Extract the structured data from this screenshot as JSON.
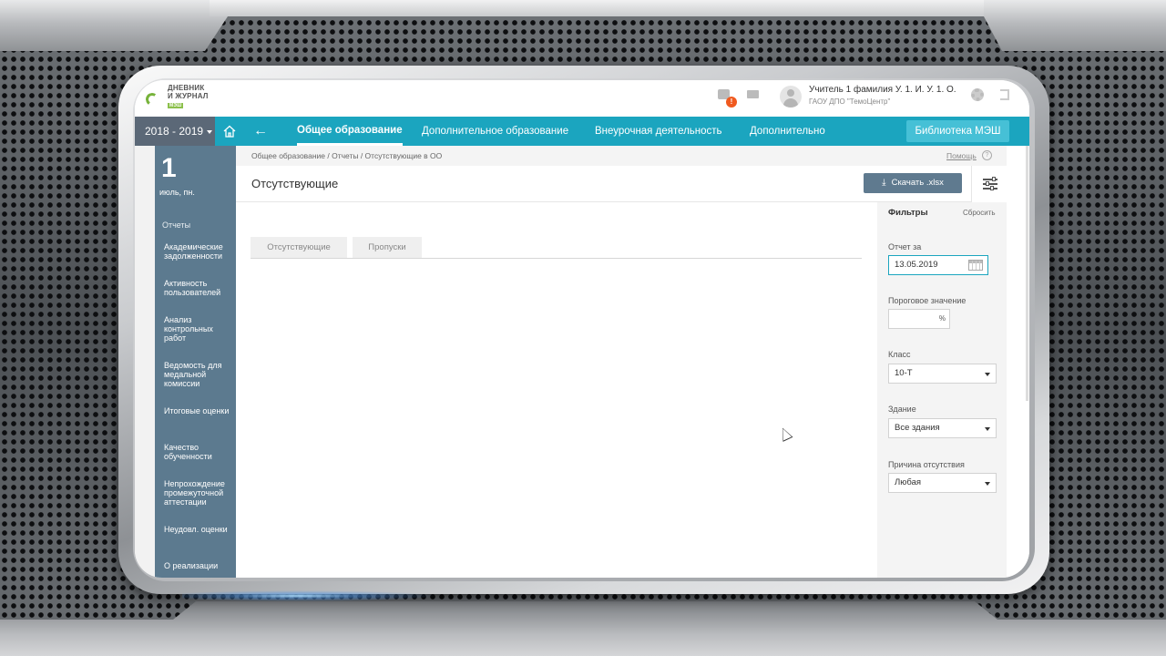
{
  "header": {
    "logo_line1": "ДНЕВНИК",
    "logo_line2": "И ЖУРНАЛ",
    "logo_badge": "МЭШ",
    "alert_count": "!",
    "user_name": "Учитель 1 фамилия У. 1. И. У. 1. О.",
    "user_org": "ГАОУ ДПО \"ТемоЦентр\""
  },
  "nav": {
    "year": "2018 - 2019",
    "items": [
      {
        "label": "Общее образование",
        "active": true
      },
      {
        "label": "Дополнительное образование",
        "active": false
      },
      {
        "label": "Внеурочная деятельность",
        "active": false
      },
      {
        "label": "Дополнительно",
        "active": false
      }
    ],
    "library_button": "Библиотека МЭШ"
  },
  "sidebar": {
    "date_number": "1",
    "date_label": "июль, пн.",
    "section": "Отчеты",
    "items": [
      "Академические задолженности",
      "Активность пользователей",
      "Анализ контрольных работ",
      "Ведомость для медальной комиссии",
      "Итоговые оценки",
      "Качество обученности",
      "Непрохождение промежуточной аттестации",
      "Неудовл. оценки",
      "О реализации"
    ]
  },
  "breadcrumb": "Общее образование / Отчеты / Отсутствующие в ОО",
  "help_label": "Помощь",
  "help_icon": "?",
  "page_title": "Отсутствующие",
  "download_button": "Скачать .xlsx",
  "tabs": [
    "Отсутствующие",
    "Пропуски"
  ],
  "filters": {
    "title": "Фильтры",
    "reset": "Сбросить",
    "report_date_label": "Отчет за",
    "report_date_value": "13.05.2019",
    "threshold_label": "Пороговое значение",
    "threshold_value": "",
    "threshold_unit": "%",
    "class_label": "Класс",
    "class_value": "10-Т",
    "building_label": "Здание",
    "building_value": "Все здания",
    "reason_label": "Причина отсутствия",
    "reason_value": "Любая"
  },
  "colors": {
    "nav_bg": "#1ba5bf",
    "sidebar_bg": "#5c7a8f",
    "year_bg": "#5b6877",
    "download_bg": "#5f7a8f",
    "alert_badge": "#f05a1f",
    "logo_green": "#8cc04b"
  }
}
